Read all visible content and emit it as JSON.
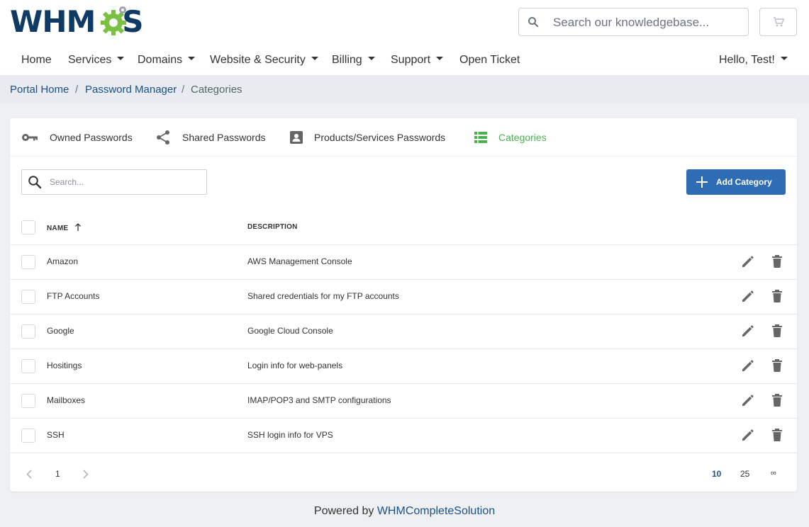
{
  "brand": {
    "logo_prefix": "WHM",
    "logo_suffix": "S",
    "gear_color": "#7ac142"
  },
  "header": {
    "search_placeholder": "Search our knowledgebase..."
  },
  "nav": {
    "items": [
      {
        "label": "Home",
        "dropdown": false
      },
      {
        "label": "Services",
        "dropdown": true
      },
      {
        "label": "Domains",
        "dropdown": true
      },
      {
        "label": "Website & Security",
        "dropdown": true
      },
      {
        "label": "Billing",
        "dropdown": true
      },
      {
        "label": "Support",
        "dropdown": true
      },
      {
        "label": "Open Ticket",
        "dropdown": false
      }
    ],
    "user": "Hello, Test!"
  },
  "breadcrumb": {
    "home": "Portal Home",
    "section": "Password Manager",
    "current": "Categories",
    "separator": "/"
  },
  "tabs": [
    {
      "label": "Owned Passwords",
      "icon": "key-icon",
      "active": false
    },
    {
      "label": "Shared Passwords",
      "icon": "share-icon",
      "active": false
    },
    {
      "label": "Products/Services Passwords",
      "icon": "contact-card-icon",
      "active": false
    },
    {
      "label": "Categories",
      "icon": "list-icon",
      "active": true
    }
  ],
  "toolbar": {
    "search_placeholder": "Search...",
    "add_label": "Add Category"
  },
  "table": {
    "columns": {
      "name": "NAME",
      "description": "DESCRIPTION"
    },
    "sort": "name-asc",
    "rows": [
      {
        "name": "Amazon",
        "description": "AWS Management Console"
      },
      {
        "name": "FTP Accounts",
        "description": "Shared credentials for my FTP accounts"
      },
      {
        "name": "Google",
        "description": "Google Cloud Console"
      },
      {
        "name": "Hositings",
        "description": "Login info for web-panels"
      },
      {
        "name": "Mailboxes",
        "description": "IMAP/POP3 and SMTP configurations"
      },
      {
        "name": "SSH",
        "description": "SSH login info for VPS"
      }
    ]
  },
  "pagination": {
    "current_page": "1",
    "page_sizes": [
      "10",
      "25",
      "∞"
    ],
    "selected_size": "10"
  },
  "footer": {
    "prefix": "Powered by ",
    "link": "WHMCompleteSolution"
  },
  "colors": {
    "accent": "#2e6db4",
    "active_tab": "#4caf50",
    "brand_navy": "#0f3a63"
  }
}
